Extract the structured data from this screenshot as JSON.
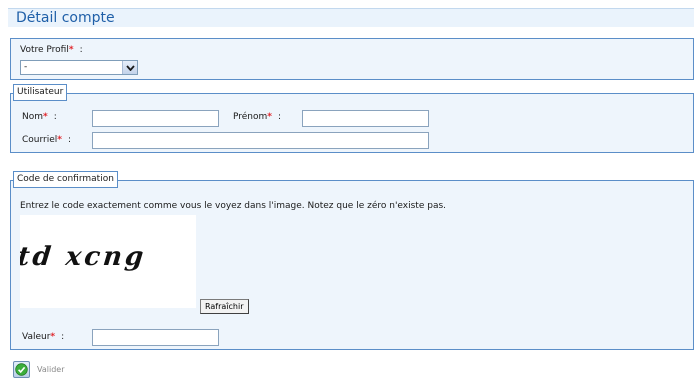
{
  "header": {
    "title": "Détail compte"
  },
  "profile": {
    "label": "Votre Profil",
    "required_mark": "*",
    "colon": ":",
    "select_value": "-"
  },
  "user": {
    "legend": "Utilisateur",
    "nom_label": "Nom",
    "prenom_label": "Prénom",
    "courriel_label": "Courriel",
    "required_mark": "*",
    "colon": ":",
    "nom_value": "",
    "prenom_value": "",
    "courriel_value": ""
  },
  "confirmation": {
    "legend": "Code de confirmation",
    "instructions": "Entrez le code exactement comme vous le voyez dans l'image. Notez que le zéro n'existe pas.",
    "captcha_text": "td xcng",
    "refresh_label": "Rafraîchir",
    "value_label": "Valeur",
    "required_mark": "*",
    "colon": ":",
    "value": ""
  },
  "actions": {
    "validate_label": "Valider"
  },
  "colors": {
    "title_blue": "#1f5fa8",
    "box_border": "#5b8ec8",
    "box_bg": "#eef5fc",
    "required_red": "#e0262b"
  },
  "icons": {
    "validate": "check-icon",
    "dropdown": "chevron-down-icon"
  }
}
